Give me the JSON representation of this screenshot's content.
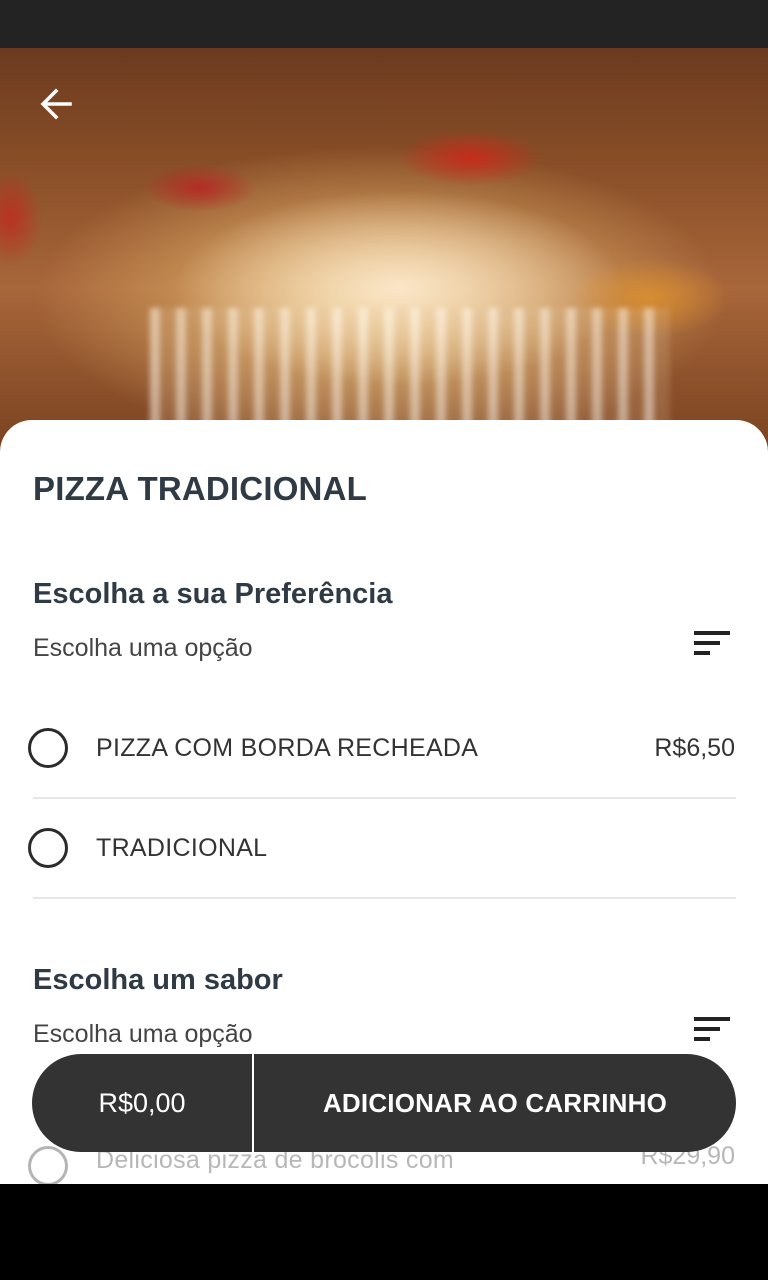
{
  "product": {
    "title": "PIZZA TRADICIONAL"
  },
  "groups": [
    {
      "title": "Escolha a sua Preferência",
      "subtitle": "Escolha uma opção",
      "options": [
        {
          "label": "PIZZA COM BORDA RECHEADA",
          "price": "R$6,50"
        },
        {
          "label": "TRADICIONAL",
          "price": ""
        }
      ]
    },
    {
      "title": "Escolha um sabor",
      "subtitle": "Escolha uma opção",
      "options": [
        {
          "label": "Deliciosa pizza de brocolis com",
          "price": "R$29,90"
        }
      ]
    }
  ],
  "cart": {
    "total": "R$0,00",
    "button_label": "ADICIONAR AO CARRINHO"
  },
  "icons": {
    "back": "arrow-left-icon",
    "sort": "sort-lines-icon"
  },
  "colors": {
    "title": "#2f3a44",
    "cart_bar": "#333333",
    "status_bar": "#232323"
  }
}
